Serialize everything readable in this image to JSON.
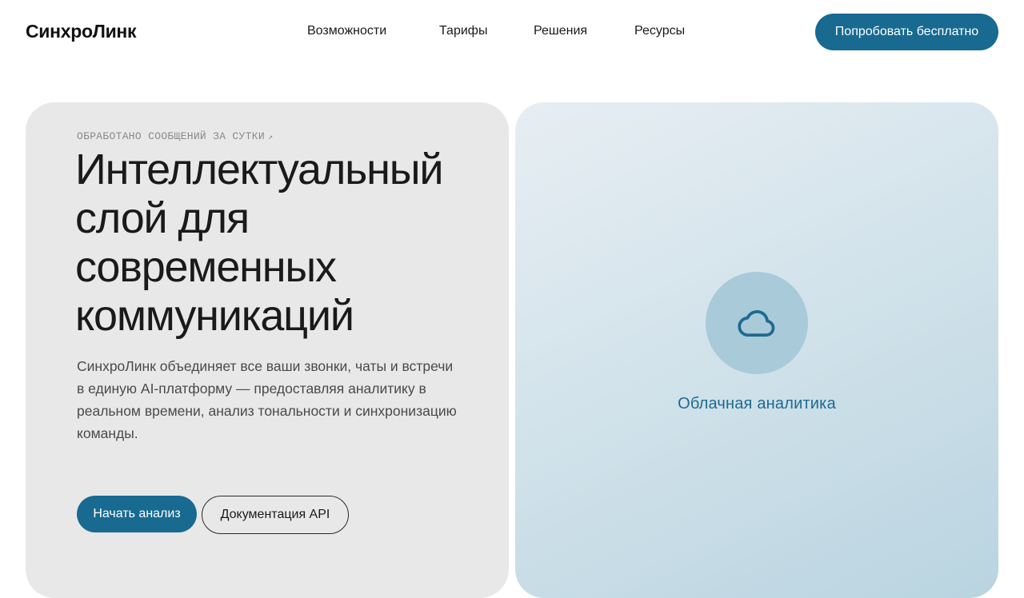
{
  "header": {
    "logo": "СинхроЛинк",
    "nav": [
      {
        "label": "Возможности"
      },
      {
        "label": "Тарифы"
      },
      {
        "label": "Решения"
      },
      {
        "label": "Ресурсы"
      }
    ],
    "cta_label": "Попробовать бесплатно"
  },
  "hero": {
    "eyebrow": "ОБРАБОТАНО СООБЩЕНИЙ ЗА СУТКИ",
    "eyebrow_icon": "arrow-up-right-icon",
    "headline_lines": [
      "Интеллектуальный",
      "слой для",
      "современных",
      "коммуникаций"
    ],
    "description": "СинхроЛинк объединяет все ваши звонки, чаты и встречи в единую AI-платформу — предоставляя аналитику в реальном времени, анализ тональности и синхронизацию команды.",
    "primary_button": "Начать анализ",
    "secondary_button": "Документация API"
  },
  "feature_card": {
    "icon": "cloud-icon",
    "label": "Облачная аналитика"
  },
  "colors": {
    "accent": "#186a91",
    "card_left_bg": "#e8e8e8",
    "card_right_gradient_start": "#e7eef3",
    "card_right_gradient_end": "#b9d4e0",
    "icon_circle_bg": "#a9cad9"
  }
}
